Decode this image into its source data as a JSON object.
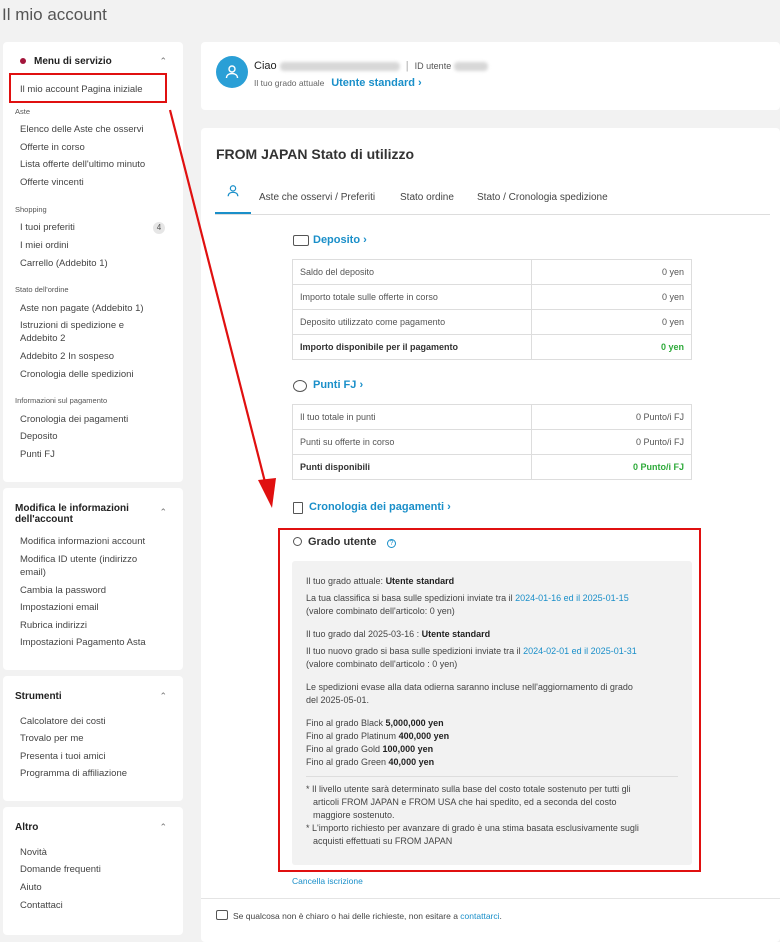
{
  "page_title": "Il mio account",
  "sidebar": {
    "service_menu": {
      "title": "Menu di servizio",
      "home_link": "Il mio account Pagina iniziale",
      "auctions_label": "Aste",
      "auctions": [
        "Elenco delle Aste che osservi",
        "Offerte in corso",
        "Lista offerte dell'ultimo minuto",
        "Offerte vincenti"
      ],
      "shopping_label": "Shopping",
      "shopping": [
        "I tuoi preferiti",
        "I miei ordini",
        "Carrello (Addebito 1)"
      ],
      "favorites_count": "4",
      "order_state_label": "Stato dell'ordine",
      "order_state": [
        "Aste non pagate (Addebito 1)",
        "Istruzioni di spedizione e",
        "Addebito 2",
        "Addebito 2 In sospeso",
        "Cronologia delle spedizioni"
      ],
      "payment_label": "Informazioni sul pagamento",
      "payment": [
        "Cronologia dei pagamenti",
        "Deposito",
        "Punti FJ"
      ]
    },
    "account_edit": {
      "title_line1": "Modifica le informazioni",
      "title_line2": "dell'account",
      "items": [
        "Modifica informazioni account",
        "Modifica ID utente (indirizzo",
        "email)",
        "Cambia la password",
        "Impostazioni email",
        "Rubrica indirizzi",
        "Impostazioni Pagamento Asta"
      ]
    },
    "tools": {
      "title": "Strumenti",
      "items": [
        "Calcolatore dei costi",
        "Trovalo per me",
        "Presenta i tuoi amici",
        "Programma di affiliazione"
      ]
    },
    "other": {
      "title": "Altro",
      "items": [
        "Novità",
        "Domande frequenti",
        "Aiuto",
        "Contattaci"
      ]
    }
  },
  "user": {
    "greeting": "Ciao",
    "id_label": "ID utente",
    "grade_label": "Il tuo grado attuale",
    "grade_value": "Utente standard ›"
  },
  "status": {
    "title": "FROM JAPAN Stato di utilizzo",
    "tabs": [
      "Aste che osservi / Preferiti",
      "Stato ordine",
      "Stato / Cronologia spedizione"
    ],
    "deposit": {
      "title": "Deposito ›",
      "rows": [
        {
          "label": "Saldo del deposito",
          "value": "0 yen"
        },
        {
          "label": "Importo totale sulle offerte in corso",
          "value": "0 yen"
        },
        {
          "label": "Deposito utilizzato come pagamento",
          "value": "0 yen"
        },
        {
          "label": "Importo disponibile per il pagamento",
          "value": "0 yen"
        }
      ]
    },
    "points": {
      "title": "Punti FJ ›",
      "rows": [
        {
          "label": "Il tuo totale in punti",
          "value": "0 Punto/i FJ"
        },
        {
          "label": "Punti su offerte in corso",
          "value": "0 Punto/i FJ"
        },
        {
          "label": "Punti disponibili",
          "value": "0 Punto/i FJ"
        }
      ]
    },
    "payments_title": "Cronologia dei pagamenti ›",
    "grade": {
      "title": "Grado utente",
      "current_prefix": "Il tuo grado attuale: ",
      "current": "Utente standard",
      "rank_prefix": "La tua classifica si basa sulle spedizioni inviate tra il ",
      "rank_dates": "2024-01-16 ed il 2025-01-15",
      "rank_note": "(valore combinato dell'articolo: 0 yen)",
      "from_prefix": "Il tuo grado dal 2025-03-16 : ",
      "from_value": "Utente standard",
      "new_prefix": "Il tuo nuovo grado si basa sulle spedizioni inviate tra il ",
      "new_dates": "2024-02-01 ed il 2025-01-31",
      "new_note": "(valore combinato dell'articolo : 0 yen)",
      "update_line1": "Le spedizioni evase alla data odierna saranno incluse nell'aggiornamento di grado",
      "update_line2": "del 2025-05-01.",
      "thresholds": [
        {
          "label": "Fino al grado Black ",
          "value": "5,000,000 yen"
        },
        {
          "label": "Fino al grado Platinum ",
          "value": "400,000 yen"
        },
        {
          "label": "Fino al grado Gold ",
          "value": "100,000 yen"
        },
        {
          "label": "Fino al grado Green ",
          "value": "40,000 yen"
        }
      ],
      "note1_l1": "* Il livello utente sarà determinato sulla base del costo totale sostenuto per tutti gli",
      "note1_l2": "articoli FROM JAPAN e FROM USA che hai spedito, ed a seconda del costo",
      "note1_l3": "maggiore sostenuto.",
      "note2_l1": "* L'importo richiesto per avanzare di grado è una stima basata esclusivamente sugli",
      "note2_l2": "acquisti effettuati su FROM JAPAN"
    },
    "unsubscribe": "Cancella iscrizione",
    "footer_text": "Se qualcosa non è chiaro o hai delle richieste, non esitare a ",
    "footer_link": "contattarci",
    "footer_end": "."
  },
  "colors": {
    "accent": "#1a8fc9",
    "brand": "#a3153b",
    "success": "#2eaa3a",
    "annotation": "#e01010"
  }
}
